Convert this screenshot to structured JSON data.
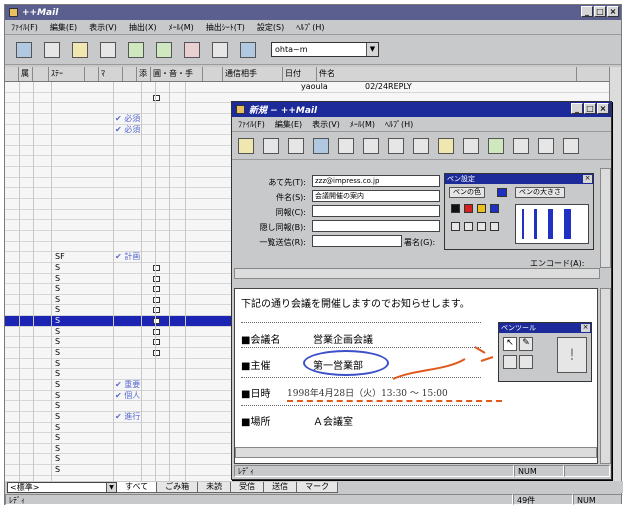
{
  "main": {
    "title": "++Mail",
    "menu": [
      "ﾌｧｲﾙ(F)",
      "編集(E)",
      "表示(V)",
      "抽出(X)",
      "ﾒｰﾙ(M)",
      "抽出ｼｰﾄ(T)",
      "設定(S)",
      "ﾍﾙﾌﾟ(H)"
    ],
    "account_combo": "ohta~m",
    "columns": [
      "",
      "属",
      "",
      "ｽﾃｰ",
      "",
      "ﾏ",
      "",
      "添",
      "圃・音・手",
      "",
      "通信相手",
      "日付",
      "件名"
    ],
    "header_partial": {
      "sender": "yaoula",
      "date_subject": "02/24REPLY"
    },
    "row_texts": [
      {
        "row": 3,
        "col": "mark",
        "text": "必須"
      },
      {
        "row": 4,
        "col": "mark",
        "text": "必須"
      },
      {
        "row": 16,
        "col": "type",
        "text": "SF"
      },
      {
        "row": 16,
        "col": "mark",
        "text": "計画"
      },
      {
        "row": 28,
        "col": "mark",
        "text": "重要"
      },
      {
        "row": 29,
        "col": "mark",
        "text": "個人"
      },
      {
        "row": 31,
        "col": "mark",
        "text": "進行"
      }
    ],
    "tab_selector": "<標準>",
    "tabs": [
      "すべて",
      "ごみ箱",
      "未読",
      "受信",
      "送信",
      "マーク"
    ],
    "status_left": "ﾚﾃﾞｨ",
    "status_count": "49件",
    "status_num": "NUM"
  },
  "compose": {
    "title": "新規 − ++Mail",
    "menu": [
      "ﾌｧｲﾙ(F)",
      "編集(E)",
      "表示(V)",
      "ﾒｰﾙ(M)",
      "ﾍﾙﾌﾟ(H)"
    ],
    "fields": {
      "to_label": "あて先(T):",
      "to_value": "zzz@impress.co.jp",
      "subject_label": "件名(S):",
      "subject_value": "会議開催の案内",
      "cc_label": "同報(C):",
      "bcc_label": "隠し同報(B):",
      "reply_label": "一覧送信(R):",
      "sig_label": "署名(G):",
      "encode_label": "エンコード(A):"
    },
    "body": {
      "intro": "下記の通り会議を開催しますのでお知らせします。",
      "meeting_label": "■会議名",
      "meeting_value": "営業企画会議",
      "host_label": "■主催",
      "host_value": "第一営業部",
      "date_label": "■日時",
      "date_value": "1998年4月28日（火）13:30 〜 15:00",
      "place_label": "■場所",
      "place_value": "Ａ会議室"
    },
    "status_left": "ﾚﾃﾞｨ",
    "status_num": "NUM"
  },
  "pen_palette": {
    "title": "ペン設定",
    "color_label": "ペンの色",
    "size_label": "ペンの大きさ",
    "colors": [
      "#111111",
      "#d42020",
      "#e8c020",
      "#2030c0"
    ]
  },
  "pen_tools": {
    "title": "ペンツール"
  },
  "colors": {
    "title_main": "#5a5f8f",
    "title_active": "#1c2a9a",
    "selection": "#1c24b4",
    "handwriting": "#e05a1c",
    "circle": "#3c50c8"
  }
}
